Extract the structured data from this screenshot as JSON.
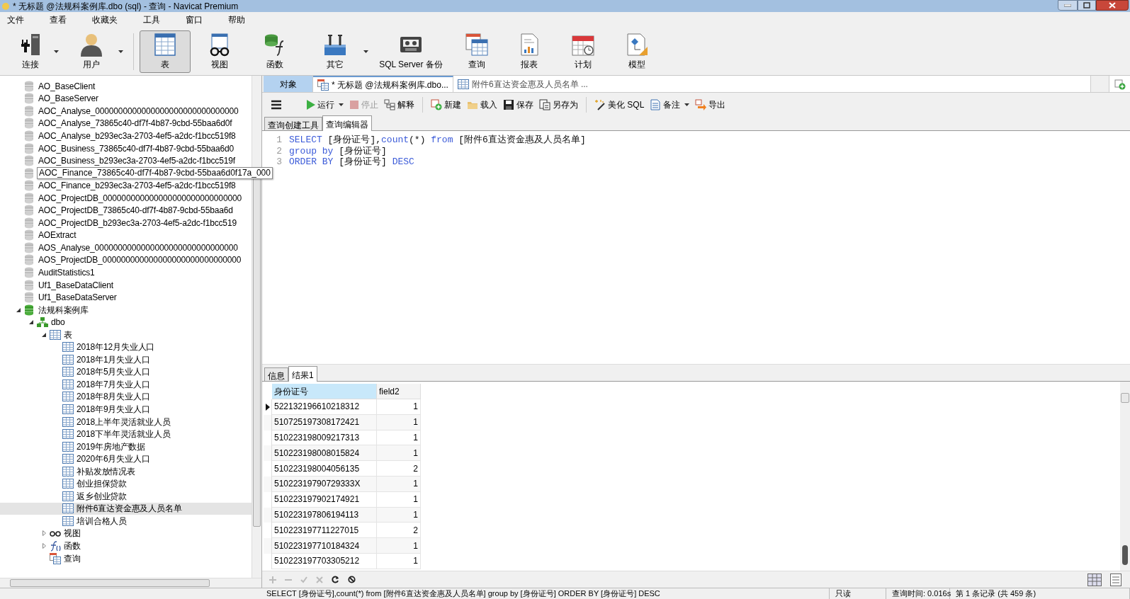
{
  "window": {
    "title": "* 无标题 @法规科案例库.dbo (sql) - 查询 - Navicat Premium"
  },
  "menu": [
    "文件",
    "查看",
    "收藏夹",
    "工具",
    "窗口",
    "帮助"
  ],
  "toolbar": [
    {
      "kind": "connect",
      "label": "连接",
      "dropdown": true,
      "selected": false
    },
    {
      "kind": "user",
      "label": "用户",
      "dropdown": true,
      "selected": false
    },
    {
      "kind": "table",
      "label": "表",
      "dropdown": false,
      "selected": true
    },
    {
      "kind": "view",
      "label": "视图",
      "dropdown": false,
      "selected": false
    },
    {
      "kind": "function",
      "label": "函数",
      "dropdown": false,
      "selected": false
    },
    {
      "kind": "other",
      "label": "其它",
      "dropdown": true,
      "selected": false
    },
    {
      "kind": "backup",
      "label": "SQL Server 备份",
      "dropdown": false,
      "selected": false
    },
    {
      "kind": "query",
      "label": "查询",
      "dropdown": false,
      "selected": false
    },
    {
      "kind": "report",
      "label": "报表",
      "dropdown": false,
      "selected": false
    },
    {
      "kind": "schedule",
      "label": "计划",
      "dropdown": false,
      "selected": false
    },
    {
      "kind": "model",
      "label": "模型",
      "dropdown": false,
      "selected": false
    }
  ],
  "tree": [
    {
      "kind": "db",
      "label": "AO_BaseClient"
    },
    {
      "kind": "db",
      "label": "AO_BaseServer"
    },
    {
      "kind": "db",
      "label": "AOC_Analyse_0000000000000000000000000000000"
    },
    {
      "kind": "db",
      "label": "AOC_Analyse_73865c40-df7f-4b87-9cbd-55baa6d0f"
    },
    {
      "kind": "db",
      "label": "AOC_Analyse_b293ec3a-2703-4ef5-a2dc-f1bcc519f8"
    },
    {
      "kind": "db",
      "label": "AOC_Business_73865c40-df7f-4b87-9cbd-55baa6d0"
    },
    {
      "kind": "db",
      "label": "AOC_Business_b293ec3a-2703-4ef5-a2dc-f1bcc519f"
    },
    {
      "kind": "db",
      "label": "AOC_Finance_73865c40-df7f-4b87-9cbd-55baa6d0f17a_000",
      "tooltip": true
    },
    {
      "kind": "db",
      "label": "AOC_Finance_b293ec3a-2703-4ef5-a2dc-f1bcc519f8"
    },
    {
      "kind": "db",
      "label": "AOC_ProjectDB_000000000000000000000000000000"
    },
    {
      "kind": "db",
      "label": "AOC_ProjectDB_73865c40-df7f-4b87-9cbd-55baa6d"
    },
    {
      "kind": "db",
      "label": "AOC_ProjectDB_b293ec3a-2703-4ef5-a2dc-f1bcc519"
    },
    {
      "kind": "db",
      "label": "AOExtract"
    },
    {
      "kind": "db",
      "label": "AOS_Analyse_0000000000000000000000000000000"
    },
    {
      "kind": "db",
      "label": "AOS_ProjectDB_000000000000000000000000000000"
    },
    {
      "kind": "db",
      "label": "AuditStatistics1"
    },
    {
      "kind": "db",
      "label": "Uf1_BaseDataClient"
    },
    {
      "kind": "db",
      "label": "Uf1_BaseDataServer"
    },
    {
      "kind": "db-open",
      "label": "法规科案例库",
      "expanded": true,
      "children": [
        {
          "kind": "schema",
          "label": "dbo",
          "expanded": true,
          "children": [
            {
              "kind": "tables",
              "label": "表",
              "expanded": true,
              "children": [
                {
                  "kind": "table",
                  "label": "2018年12月失业人口",
                  "selected": false
                },
                {
                  "kind": "table",
                  "label": "2018年1月失业人口",
                  "selected": false
                },
                {
                  "kind": "table",
                  "label": "2018年5月失业人口",
                  "selected": false
                },
                {
                  "kind": "table",
                  "label": "2018年7月失业人口",
                  "selected": false
                },
                {
                  "kind": "table",
                  "label": "2018年8月失业人口",
                  "selected": false
                },
                {
                  "kind": "table",
                  "label": "2018年9月失业人口",
                  "selected": false
                },
                {
                  "kind": "table",
                  "label": "2018上半年灵活就业人员",
                  "selected": false
                },
                {
                  "kind": "table",
                  "label": "2018下半年灵活就业人员",
                  "selected": false
                },
                {
                  "kind": "table",
                  "label": "2019年房地产数据",
                  "selected": false
                },
                {
                  "kind": "table",
                  "label": "2020年6月失业人口",
                  "selected": false
                },
                {
                  "kind": "table",
                  "label": "补贴发放情况表",
                  "selected": false
                },
                {
                  "kind": "table",
                  "label": "创业担保贷款",
                  "selected": false
                },
                {
                  "kind": "table",
                  "label": "返乡创业贷款",
                  "selected": false
                },
                {
                  "kind": "table",
                  "label": "附件6直达资金惠及人员名单",
                  "selected": true
                },
                {
                  "kind": "table",
                  "label": "培训合格人员",
                  "selected": false
                }
              ]
            },
            {
              "kind": "views",
              "label": "视图",
              "expanded": false
            },
            {
              "kind": "functions",
              "label": "函数",
              "expanded": false
            },
            {
              "kind": "queries",
              "label": "查询"
            }
          ]
        }
      ]
    }
  ],
  "tabs": [
    {
      "kind": "object",
      "label": "对象",
      "selected": false
    },
    {
      "kind": "query",
      "label": "* 无标题 @法规科案例库.dbo...",
      "selected": true
    },
    {
      "kind": "table",
      "label": "附件6直达资金惠及人员名单 ...",
      "selected": false
    }
  ],
  "editor_toolbar": [
    {
      "kind": "menu"
    },
    {
      "kind": "run",
      "label": "运行",
      "dropdown": true,
      "disabled": false
    },
    {
      "kind": "stop",
      "label": "停止",
      "disabled": true
    },
    {
      "kind": "explain",
      "label": "解释",
      "disabled": false
    },
    {
      "kind": "separator"
    },
    {
      "kind": "new",
      "label": "新建",
      "disabled": false
    },
    {
      "kind": "load",
      "label": "载入",
      "disabled": false
    },
    {
      "kind": "save",
      "label": "保存",
      "disabled": false
    },
    {
      "kind": "saveas",
      "label": "另存为",
      "disabled": false
    },
    {
      "kind": "separator"
    },
    {
      "kind": "beautify",
      "label": "美化 SQL",
      "disabled": false
    },
    {
      "kind": "comment",
      "label": "备注",
      "dropdown": true,
      "disabled": false
    },
    {
      "kind": "export",
      "label": "导出",
      "disabled": false
    }
  ],
  "sub_tabs": [
    {
      "label": "查询创建工具",
      "selected": false
    },
    {
      "label": "查询编辑器",
      "selected": true
    }
  ],
  "sql_lines": [
    {
      "number": "1",
      "segments": [
        {
          "kind": "keyword",
          "text": "SELECT"
        },
        {
          "kind": "plain",
          "text": " [身份证号],"
        },
        {
          "kind": "keyword",
          "text": "count"
        },
        {
          "kind": "plain",
          "text": "(*) "
        },
        {
          "kind": "keyword",
          "text": "from"
        },
        {
          "kind": "plain",
          "text": " [附件6直达资金惠及人员名单]"
        }
      ]
    },
    {
      "number": "2",
      "segments": [
        {
          "kind": "keyword",
          "text": "group by"
        },
        {
          "kind": "plain",
          "text": " [身份证号]"
        }
      ]
    },
    {
      "number": "3",
      "segments": [
        {
          "kind": "keyword",
          "text": "ORDER BY"
        },
        {
          "kind": "plain",
          "text": " [身份证号] "
        },
        {
          "kind": "keyword",
          "text": "DESC"
        }
      ]
    }
  ],
  "result_tabs": [
    {
      "label": "信息",
      "selected": false
    },
    {
      "label": "结果1",
      "selected": true
    }
  ],
  "table": {
    "columns": [
      {
        "label": "身份证号",
        "selected": true
      },
      {
        "label": "field2",
        "selected": false
      }
    ],
    "rows": [
      {
        "cells": [
          "522132196610218312",
          "1"
        ],
        "selected": true
      },
      {
        "cells": [
          "510725197308172421",
          "1"
        ],
        "selected": false
      },
      {
        "cells": [
          "510223198009217313",
          "1"
        ],
        "selected": false
      },
      {
        "cells": [
          "510223198008015824",
          "1"
        ],
        "selected": false
      },
      {
        "cells": [
          "510223198004056135",
          "2"
        ],
        "selected": false
      },
      {
        "cells": [
          "51022319790729333X",
          "1"
        ],
        "selected": false
      },
      {
        "cells": [
          "510223197902174921",
          "1"
        ],
        "selected": false
      },
      {
        "cells": [
          "510223197806194113",
          "1"
        ],
        "selected": false
      },
      {
        "cells": [
          "510223197711227015",
          "2"
        ],
        "selected": false
      },
      {
        "cells": [
          "510223197710184324",
          "1"
        ],
        "selected": false
      },
      {
        "cells": [
          "510223197703305212",
          "1"
        ],
        "selected": false
      }
    ]
  },
  "status_bar": [
    "SELECT [身份证号],count(*) from [附件6直达资金惠及人员名单] group by [身份证号] ORDER BY [身份证号] DESC",
    "只读",
    "查询时间: 0.016s",
    "第 1 条记录 (共 459 条)"
  ]
}
